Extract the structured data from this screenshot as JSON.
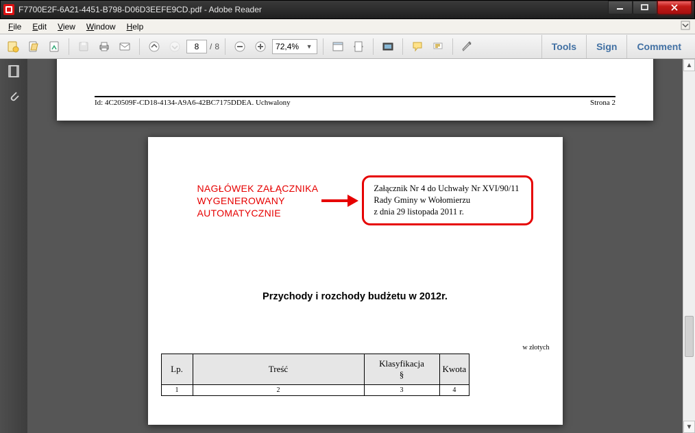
{
  "window": {
    "title": "F7700E2F-6A21-4451-B798-D06D3EEFE9CD.pdf - Adobe Reader"
  },
  "menu": {
    "file": "File",
    "edit": "Edit",
    "view": "View",
    "window": "Window",
    "help": "Help"
  },
  "toolbar": {
    "page_current": "8",
    "page_sep": "/",
    "page_total": "8",
    "zoom": "72,4%"
  },
  "right_panel": {
    "tools": "Tools",
    "sign": "Sign",
    "comment": "Comment"
  },
  "doc": {
    "footer_id": "Id: 4C20509F-CD18-4134-A9A6-42BC7175DDEA. Uchwalony",
    "footer_page": "Strona 2",
    "annotation_l1": "NAGŁÓWEK ZAŁĄCZNIKA",
    "annotation_l2": "WYGENEROWANY",
    "annotation_l3": "AUTOMATYCZNIE",
    "attach_l1": "Załącznik Nr 4 do Uchwały Nr XVI/90/11",
    "attach_l2": "Rady Gminy w Wołomierzu",
    "attach_l3": "z dnia 29 listopada 2011 r.",
    "title": "Przychody i rozchody budżetu w 2012r.",
    "unit": "w złotych",
    "cols": {
      "c1": "Lp.",
      "c2": "Treść",
      "c3l1": "Klasyfikacja",
      "c3l2": "§",
      "c4": "Kwota"
    },
    "subcols": {
      "s1": "1",
      "s2": "2",
      "s3": "3",
      "s4": "4"
    }
  }
}
